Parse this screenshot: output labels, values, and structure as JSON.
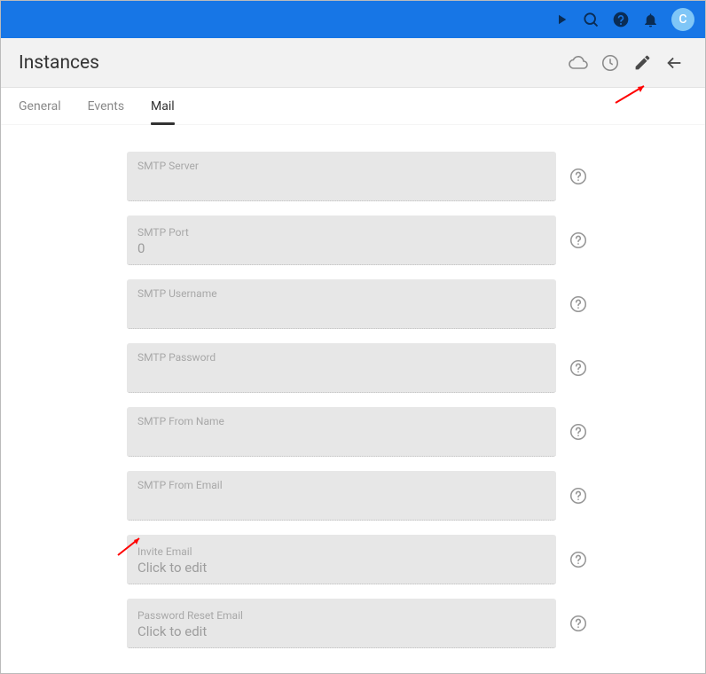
{
  "topbar": {
    "avatar_letter": "C"
  },
  "header": {
    "title": "Instances"
  },
  "tabs": [
    {
      "label": "General",
      "active": false
    },
    {
      "label": "Events",
      "active": false
    },
    {
      "label": "Mail",
      "active": true
    }
  ],
  "fields": [
    {
      "label": "SMTP Server",
      "value": null
    },
    {
      "label": "SMTP Port",
      "value": "0"
    },
    {
      "label": "SMTP Username",
      "value": null
    },
    {
      "label": "SMTP Password",
      "value": null
    },
    {
      "label": "SMTP From Name",
      "value": null
    },
    {
      "label": "SMTP From Email",
      "value": null
    },
    {
      "label": "Invite Email",
      "value": "Click to edit"
    },
    {
      "label": "Password Reset Email",
      "value": "Click to edit"
    }
  ]
}
